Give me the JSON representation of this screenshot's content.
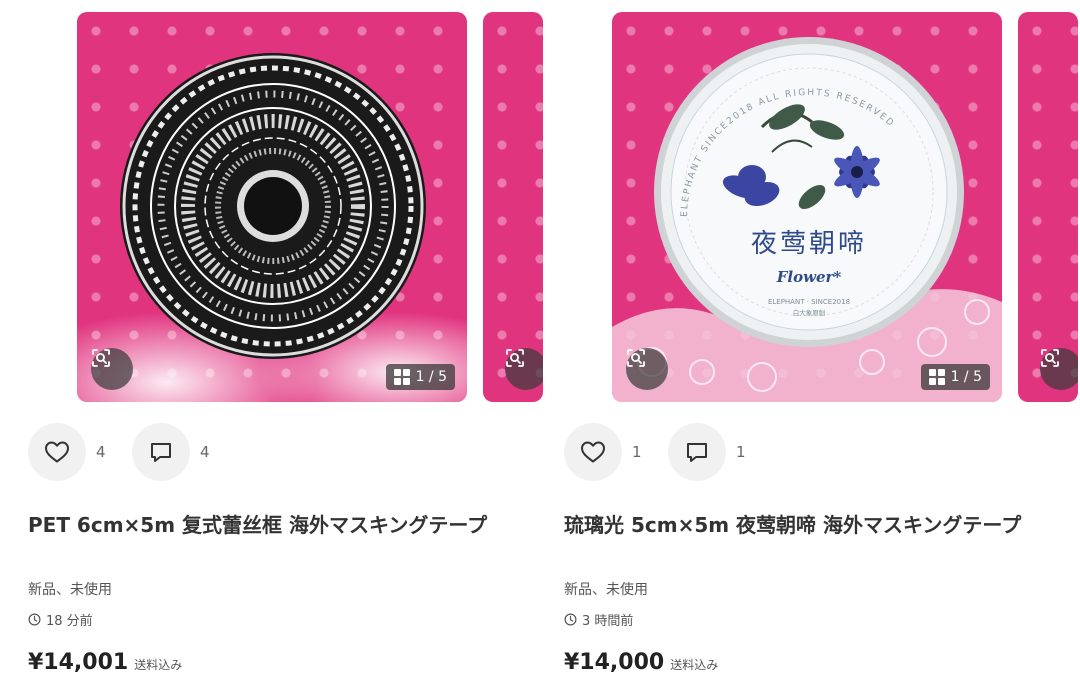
{
  "items": [
    {
      "image_counter": "1 / 5",
      "likes": "4",
      "comments": "4",
      "title": "PET 6cm×5m 复式蕾丝框 海外マスキングテープ",
      "condition": "新品、未使用",
      "time_ago": "18 分前",
      "price": "¥14,001",
      "shipping": "送料込み"
    },
    {
      "image_counter": "1 / 5",
      "likes": "1",
      "comments": "1",
      "title": "琉璃光 5cm×5m 夜莺朝啼 海外マスキングテープ",
      "condition": "新品、未使用",
      "time_ago": "3 時間前",
      "price": "¥14,000",
      "shipping": "送料込み",
      "product_label": {
        "name": "夜莺朝啼",
        "sub": "Flower*",
        "ring_text": "ELEPHANT SINCE2018 ALL RIGHTS RESERVED",
        "brand_line": "ELEPHANT · SINCE2018",
        "brand_cn": "白大象原創"
      }
    }
  ],
  "icons": {
    "lens": "image-search-icon",
    "grid": "grid-icon",
    "like": "heart-icon",
    "comment": "comment-icon",
    "clock": "clock-icon"
  },
  "colors": {
    "photo_background": "#e1347f",
    "action_button_bg": "#f1f1f1"
  }
}
